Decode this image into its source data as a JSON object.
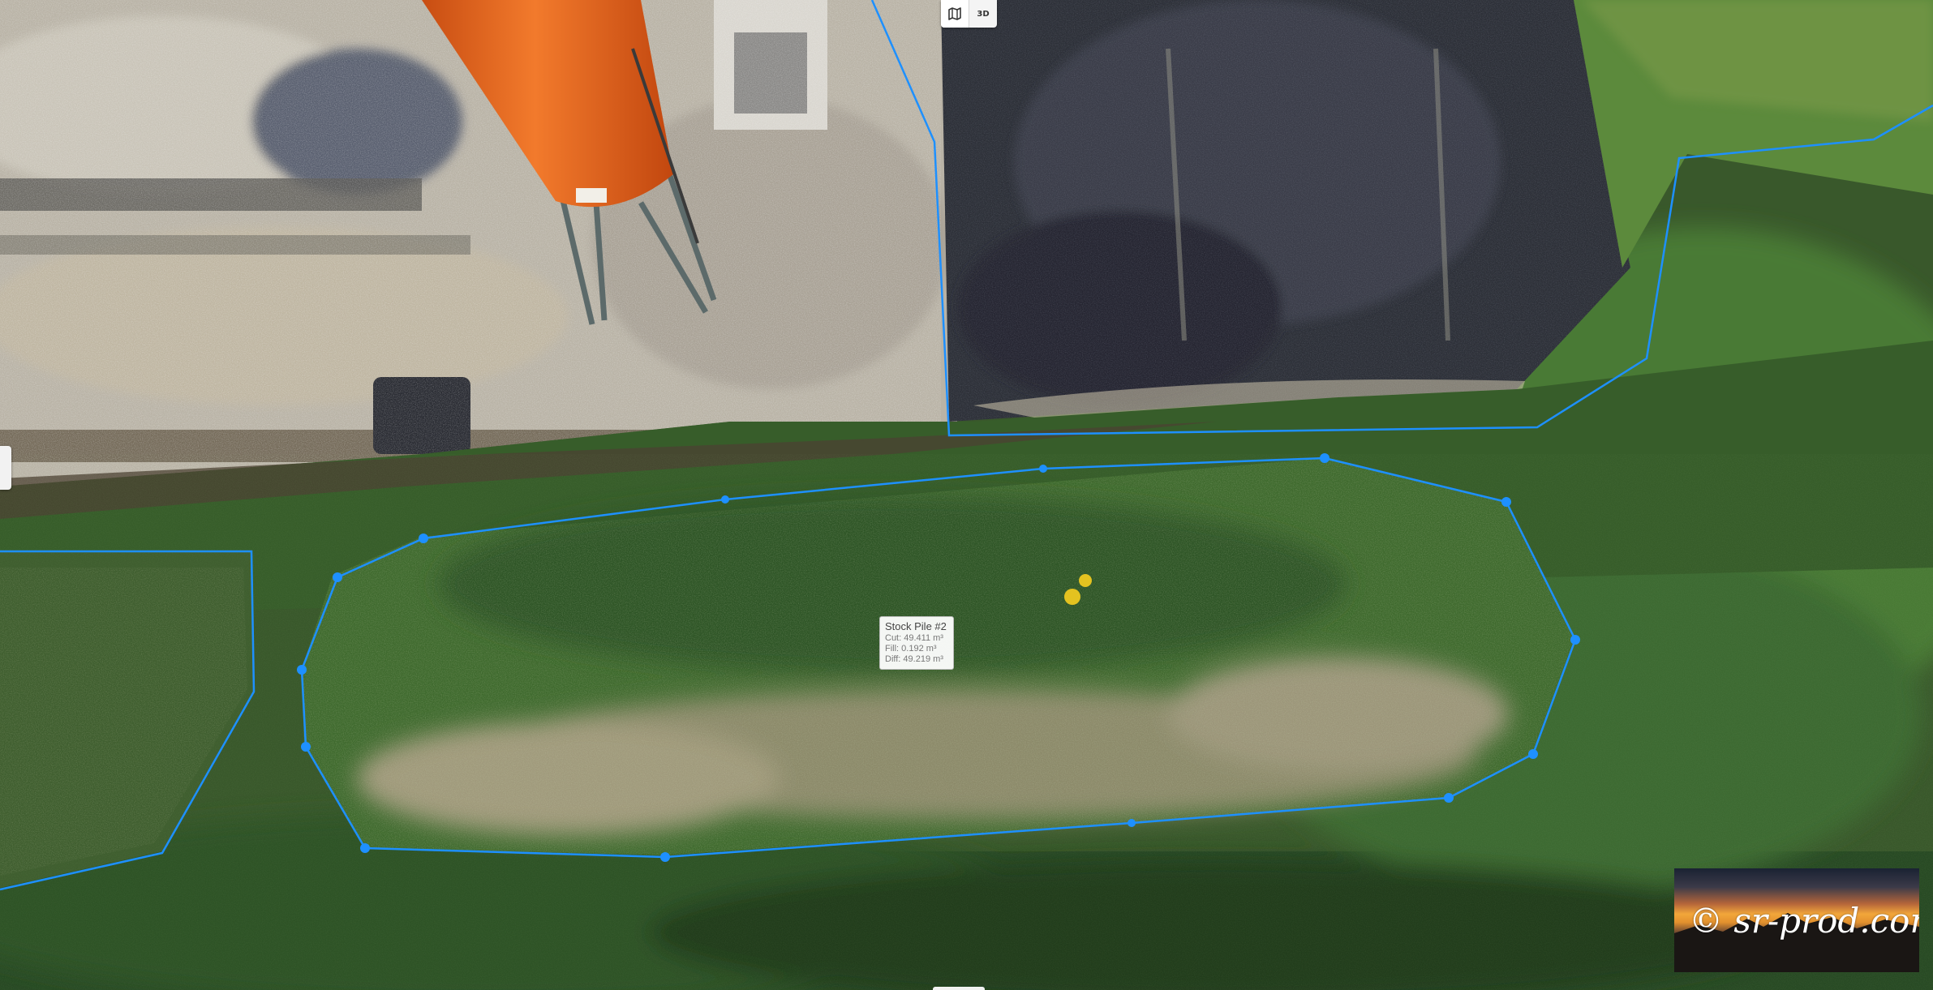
{
  "map": {
    "view_modes": [
      {
        "icon": "map-icon",
        "active": true
      },
      {
        "label": "3D",
        "icon": "cube-3d-icon",
        "active": false
      }
    ]
  },
  "measurement": {
    "title": "Stock Pile #2",
    "cut": "Cut: 49.411 m³",
    "fill": "Fill: 0.192 m³",
    "diff": "Diff: 49.219 m³",
    "outline_color": "#1e90ff"
  },
  "watermark": {
    "text": "© sr-prod.com"
  }
}
